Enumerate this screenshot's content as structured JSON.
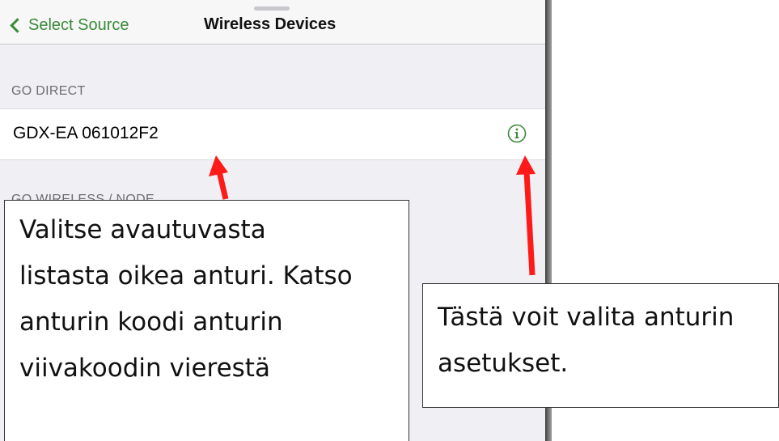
{
  "navbar": {
    "back_label": "Select Source",
    "title": "Wireless Devices"
  },
  "sections": [
    {
      "header": "GO DIRECT"
    },
    {
      "header": "GO WIRELESS / NODE"
    }
  ],
  "devices": [
    {
      "name": "GDX-EA 061012F2"
    }
  ],
  "annotations": {
    "left_lines": [
      "Valitse avautuvasta",
      "listasta oikea anturi. Katso",
      "anturin koodi anturin",
      "viivakoodin vierestä"
    ],
    "right_lines": [
      "Tästä voit valita anturin",
      "asetukset."
    ]
  },
  "colors": {
    "accent": "#3a8a3a",
    "arrow": "#ff1a1a"
  }
}
